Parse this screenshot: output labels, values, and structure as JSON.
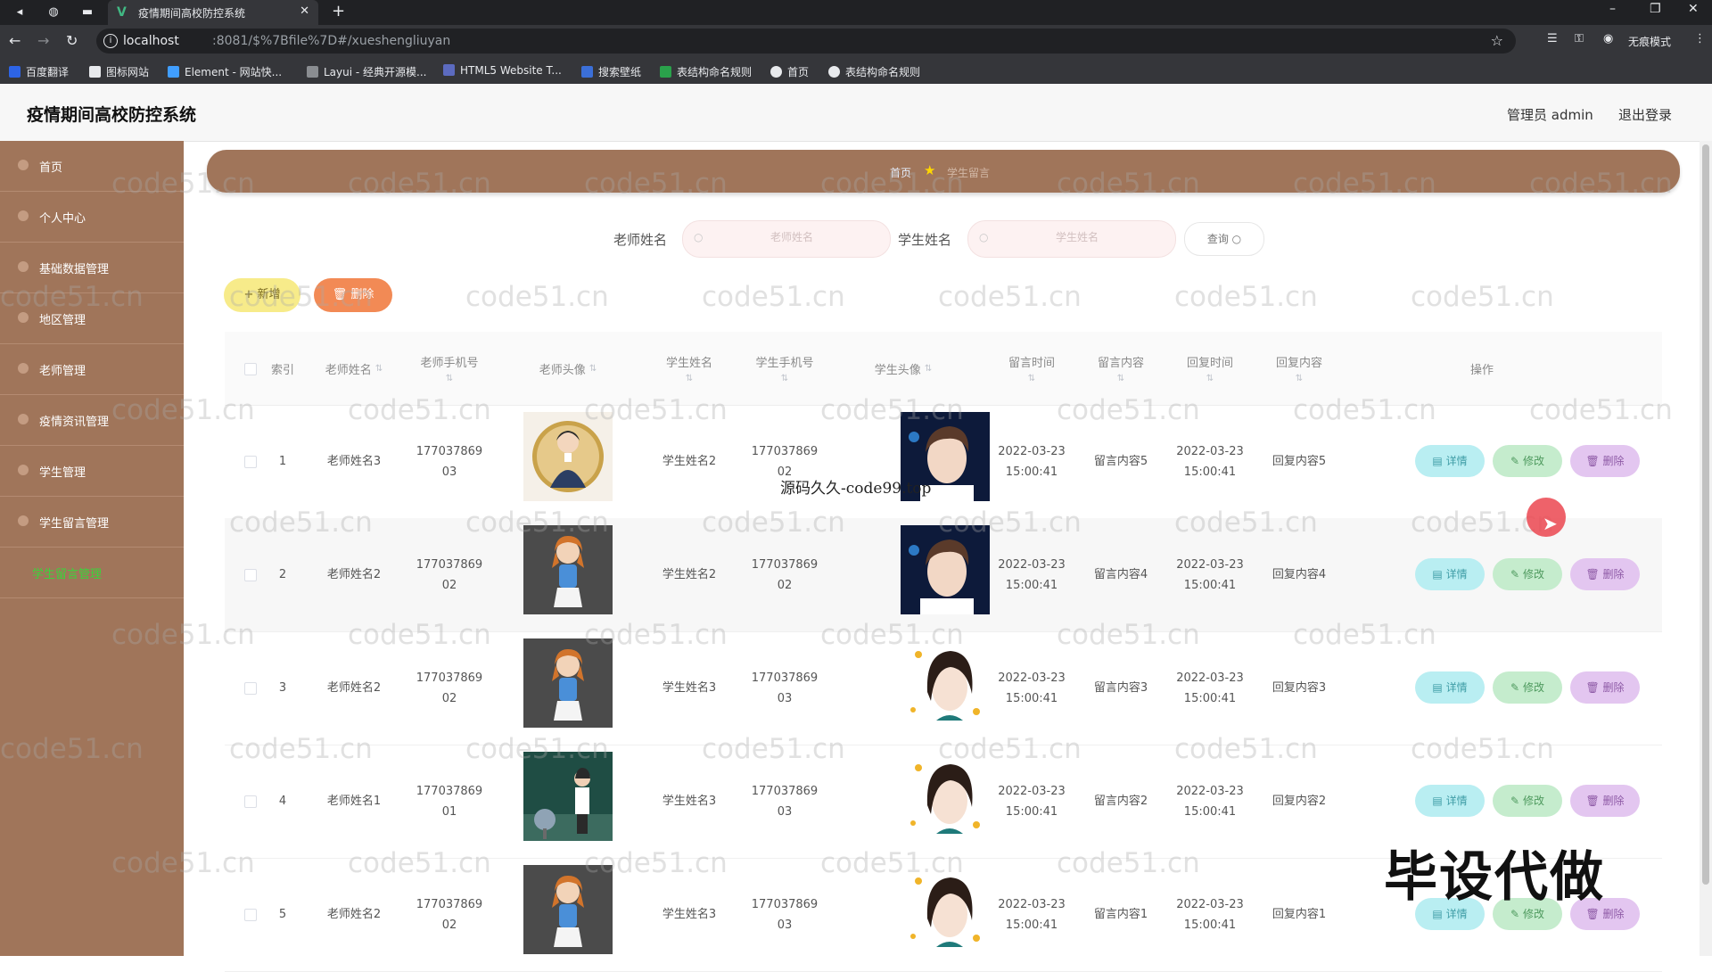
{
  "browser": {
    "tab_title": "疫情期间高校防控系统",
    "url_host": "localhost",
    "url_rest": ":8081/$%7Bfile%7D#/xueshengliuyan",
    "incognito_label": "无痕模式",
    "bookmarks": [
      "百度翻译",
      "图标网站",
      "Element - 网站快...",
      "Layui - 经典开源模...",
      "HTML5 Website T...",
      "搜索壁纸",
      "表结构命名规则",
      "首页",
      "表结构命名规则"
    ]
  },
  "header": {
    "title": "疫情期间高校防控系统",
    "admin": "管理员 admin",
    "logout": "退出登录"
  },
  "sidebar": {
    "items": [
      {
        "label": "首页"
      },
      {
        "label": "个人中心"
      },
      {
        "label": "基础数据管理"
      },
      {
        "label": "地区管理"
      },
      {
        "label": "老师管理"
      },
      {
        "label": "疫情资讯管理"
      },
      {
        "label": "学生管理"
      },
      {
        "label": "学生留言管理"
      }
    ],
    "sub_item": "学生留言管理"
  },
  "breadcrumb": {
    "home": "首页",
    "current": "学生留言"
  },
  "search": {
    "teacher_label": "老师姓名",
    "teacher_placeholder": "老师姓名",
    "student_label": "学生姓名",
    "student_placeholder": "学生姓名",
    "query_label": "查询"
  },
  "actions": {
    "add_label": "+ 新增",
    "delete_label": "删除"
  },
  "table": {
    "headers": {
      "index": "索引",
      "teacher_name": "老师姓名",
      "teacher_phone": "老师手机号",
      "teacher_avatar": "老师头像",
      "student_name": "学生姓名",
      "student_phone": "学生手机号",
      "student_avatar": "学生头像",
      "msg_time": "留言时间",
      "msg_content": "留言内容",
      "reply_time": "回复时间",
      "reply_content": "回复内容",
      "ops": "操作"
    },
    "rows": [
      {
        "index": "1",
        "teacher_name": "老师姓名3",
        "teacher_phone_a": "177037869",
        "teacher_phone_b": "03",
        "student_name": "学生姓名2",
        "student_phone_a": "177037869",
        "student_phone_b": "02",
        "msg_date": "2022-03-23",
        "msg_clock": "15:00:41",
        "msg_content": "留言内容5",
        "reply_date": "2022-03-23",
        "reply_clock": "15:00:41",
        "reply_content": "回复内容5"
      },
      {
        "index": "2",
        "teacher_name": "老师姓名2",
        "teacher_phone_a": "177037869",
        "teacher_phone_b": "02",
        "student_name": "学生姓名2",
        "student_phone_a": "177037869",
        "student_phone_b": "02",
        "msg_date": "2022-03-23",
        "msg_clock": "15:00:41",
        "msg_content": "留言内容4",
        "reply_date": "2022-03-23",
        "reply_clock": "15:00:41",
        "reply_content": "回复内容4"
      },
      {
        "index": "3",
        "teacher_name": "老师姓名2",
        "teacher_phone_a": "177037869",
        "teacher_phone_b": "02",
        "student_name": "学生姓名3",
        "student_phone_a": "177037869",
        "student_phone_b": "03",
        "msg_date": "2022-03-23",
        "msg_clock": "15:00:41",
        "msg_content": "留言内容3",
        "reply_date": "2022-03-23",
        "reply_clock": "15:00:41",
        "reply_content": "回复内容3"
      },
      {
        "index": "4",
        "teacher_name": "老师姓名1",
        "teacher_phone_a": "177037869",
        "teacher_phone_b": "01",
        "student_name": "学生姓名3",
        "student_phone_a": "177037869",
        "student_phone_b": "03",
        "msg_date": "2022-03-23",
        "msg_clock": "15:00:41",
        "msg_content": "留言内容2",
        "reply_date": "2022-03-23",
        "reply_clock": "15:00:41",
        "reply_content": "回复内容2"
      },
      {
        "index": "5",
        "teacher_name": "老师姓名2",
        "teacher_phone_a": "177037869",
        "teacher_phone_b": "02",
        "student_name": "学生姓名3",
        "student_phone_a": "177037869",
        "student_phone_b": "03",
        "msg_date": "2022-03-23",
        "msg_clock": "15:00:41",
        "msg_content": "留言内容1",
        "reply_date": "2022-03-23",
        "reply_clock": "15:00:41",
        "reply_content": "回复内容1"
      }
    ],
    "op_labels": {
      "detail": "详情",
      "edit": "修改",
      "delete": "删除"
    }
  },
  "watermark": "code51.cn",
  "overlay": {
    "code99": "源码久久-code99.top",
    "bishe": "毕设代做"
  },
  "colors": {
    "sidebar": "#a0755a",
    "submenu_active": "#3bd43b",
    "add": "#f7eb8a",
    "delete": "#f28a55",
    "detail": "#b9eef2",
    "edit": "#c5eccd",
    "row_delete": "#e3c6f0"
  }
}
